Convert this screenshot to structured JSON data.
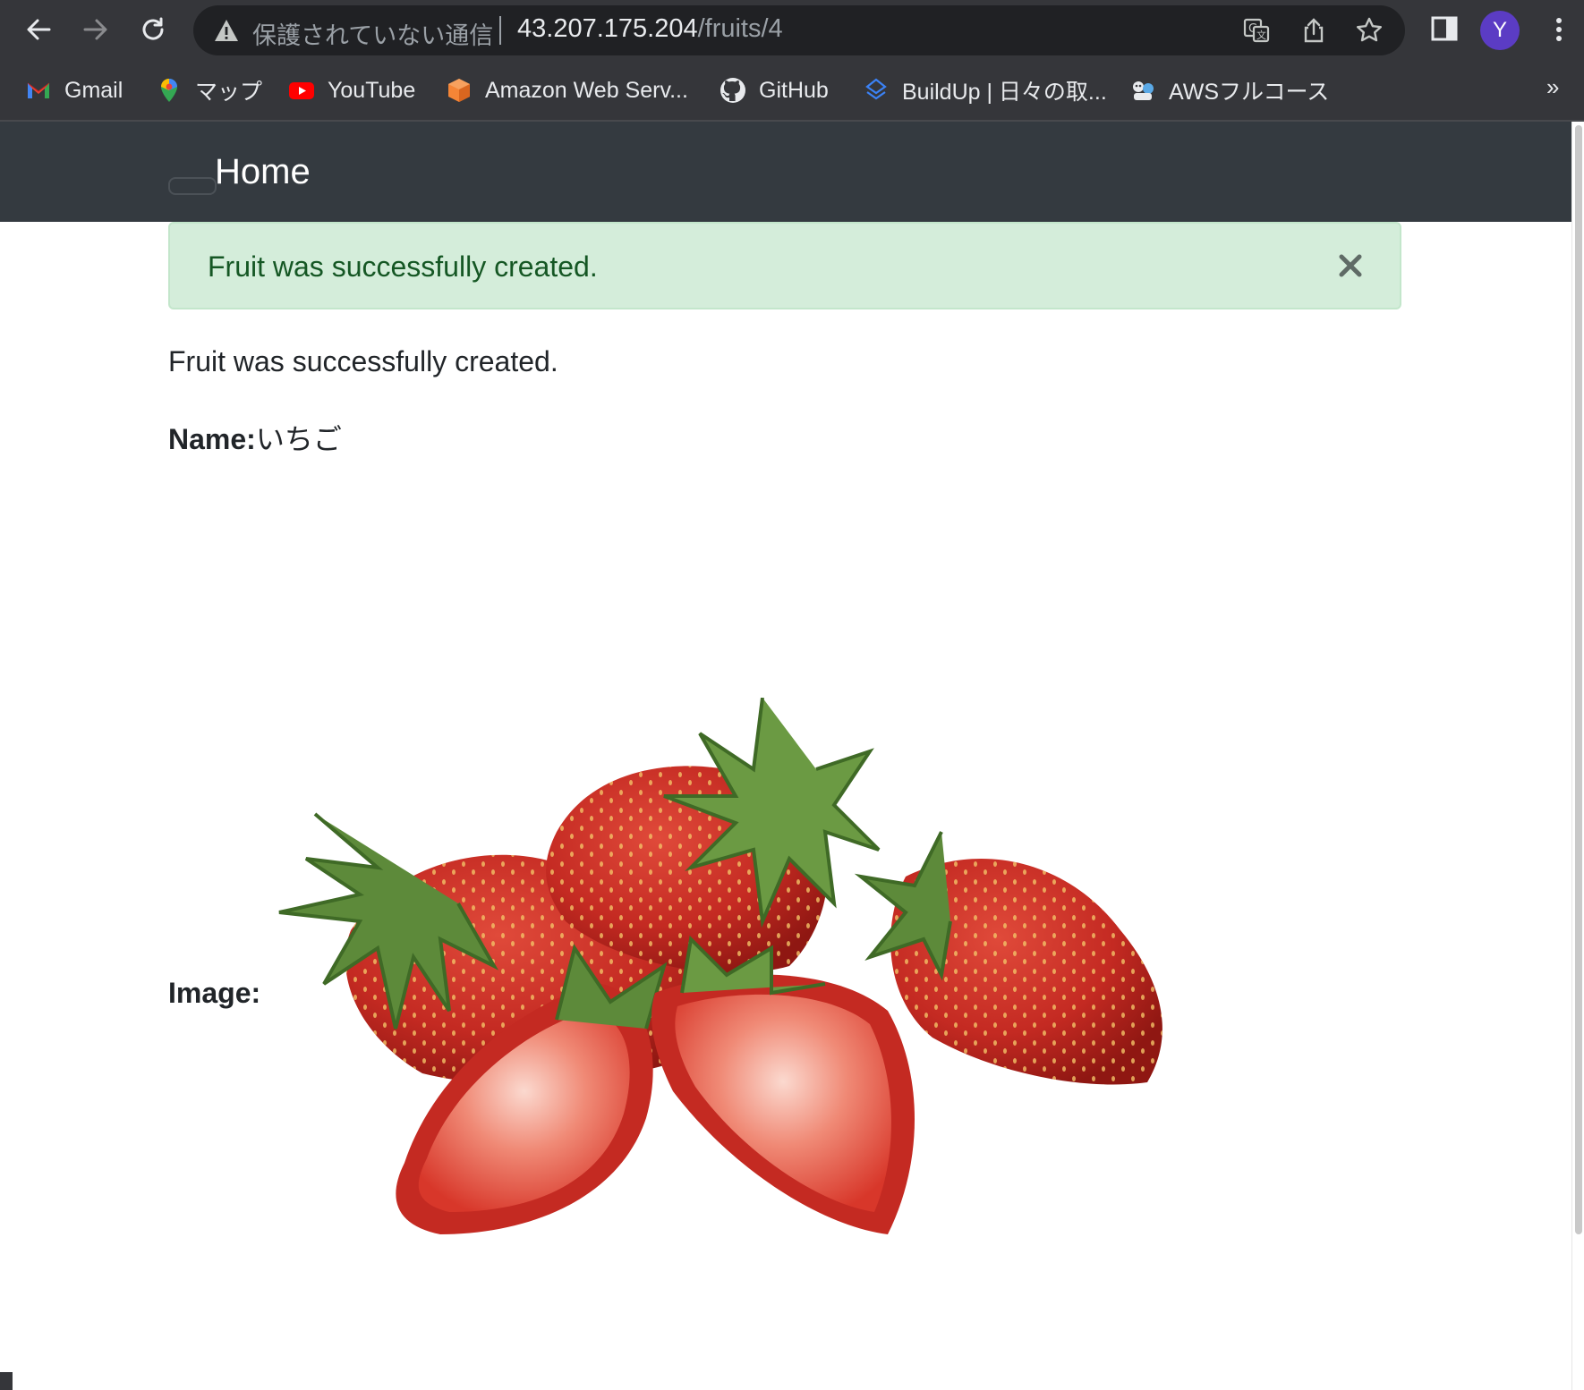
{
  "browser": {
    "omnibox": {
      "security_label": "保護されていない通信",
      "url_host": "43.207.175.204",
      "url_path": "/fruits/4"
    },
    "profile_initial": "Y",
    "bookmarks": [
      {
        "label": "Gmail",
        "icon": "gmail-icon"
      },
      {
        "label": "マップ",
        "icon": "maps-pin-icon"
      },
      {
        "label": "YouTube",
        "icon": "youtube-icon"
      },
      {
        "label": "Amazon Web Serv...",
        "icon": "aws-cube-icon"
      },
      {
        "label": "GitHub",
        "icon": "github-icon"
      },
      {
        "label": "BuildUp | 日々の取...",
        "icon": "buildup-icon"
      },
      {
        "label": "AWSフルコース",
        "icon": "aws-course-icon"
      }
    ],
    "bookmarks_overflow": "»"
  },
  "navbar": {
    "home_label": "Home"
  },
  "alert": {
    "message": "Fruit was successfully created.",
    "close_symbol": "✕"
  },
  "main": {
    "notice": "Fruit was successfully created.",
    "name_label": "Name:",
    "name_value": "いちご",
    "image_label": "Image:"
  },
  "colors": {
    "chrome_bg": "#35363a",
    "navbar_bg": "#343a40",
    "alert_bg": "#d4edda",
    "alert_text": "#155724",
    "profile_avatar": "#5b3cc4"
  }
}
